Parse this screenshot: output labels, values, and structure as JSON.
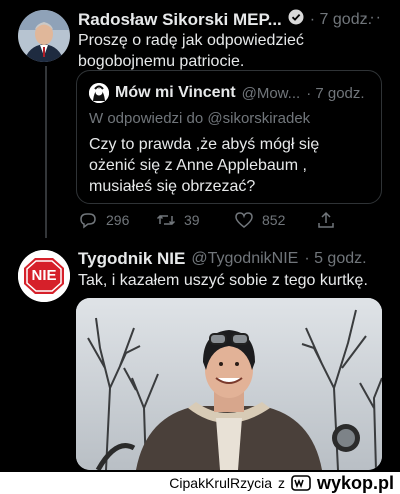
{
  "tweet1": {
    "name": "Radosław Sikorski MEP...",
    "time": "· 7 godz.",
    "text": "Proszę o radę jak odpowiedzieć bogobojnemu patriocie.",
    "more": "···"
  },
  "quote": {
    "name": "Mów mi Vincent",
    "handle": "@Mow...",
    "time": "· 7 godz.",
    "reply_prefix": "W odpowiedzi do",
    "reply_handle": "@sikorskiradek",
    "text": "Czy to prawda ,że abyś mógł się ożenić się z Anne Applebaum , musiałeś się obrzezać?"
  },
  "metrics": {
    "replies": "296",
    "retweets": "39",
    "likes": "852"
  },
  "tweet2": {
    "name": "Tygodnik NIE",
    "handle": "@TygodnikNIE",
    "time": "· 5 godz.",
    "text": "Tak, i kazałem uszyć sobie z tego kurtkę.",
    "avatar_text": "NIE"
  },
  "footer": {
    "user": "CipakKrulRzycia",
    "separator": "z",
    "brand": "wykop.pl"
  },
  "colors": {
    "background": "#000000",
    "text": "#e7e9ea",
    "muted": "#71767b",
    "verified": "#d9d9d9",
    "nie_red": "#d6202a"
  }
}
